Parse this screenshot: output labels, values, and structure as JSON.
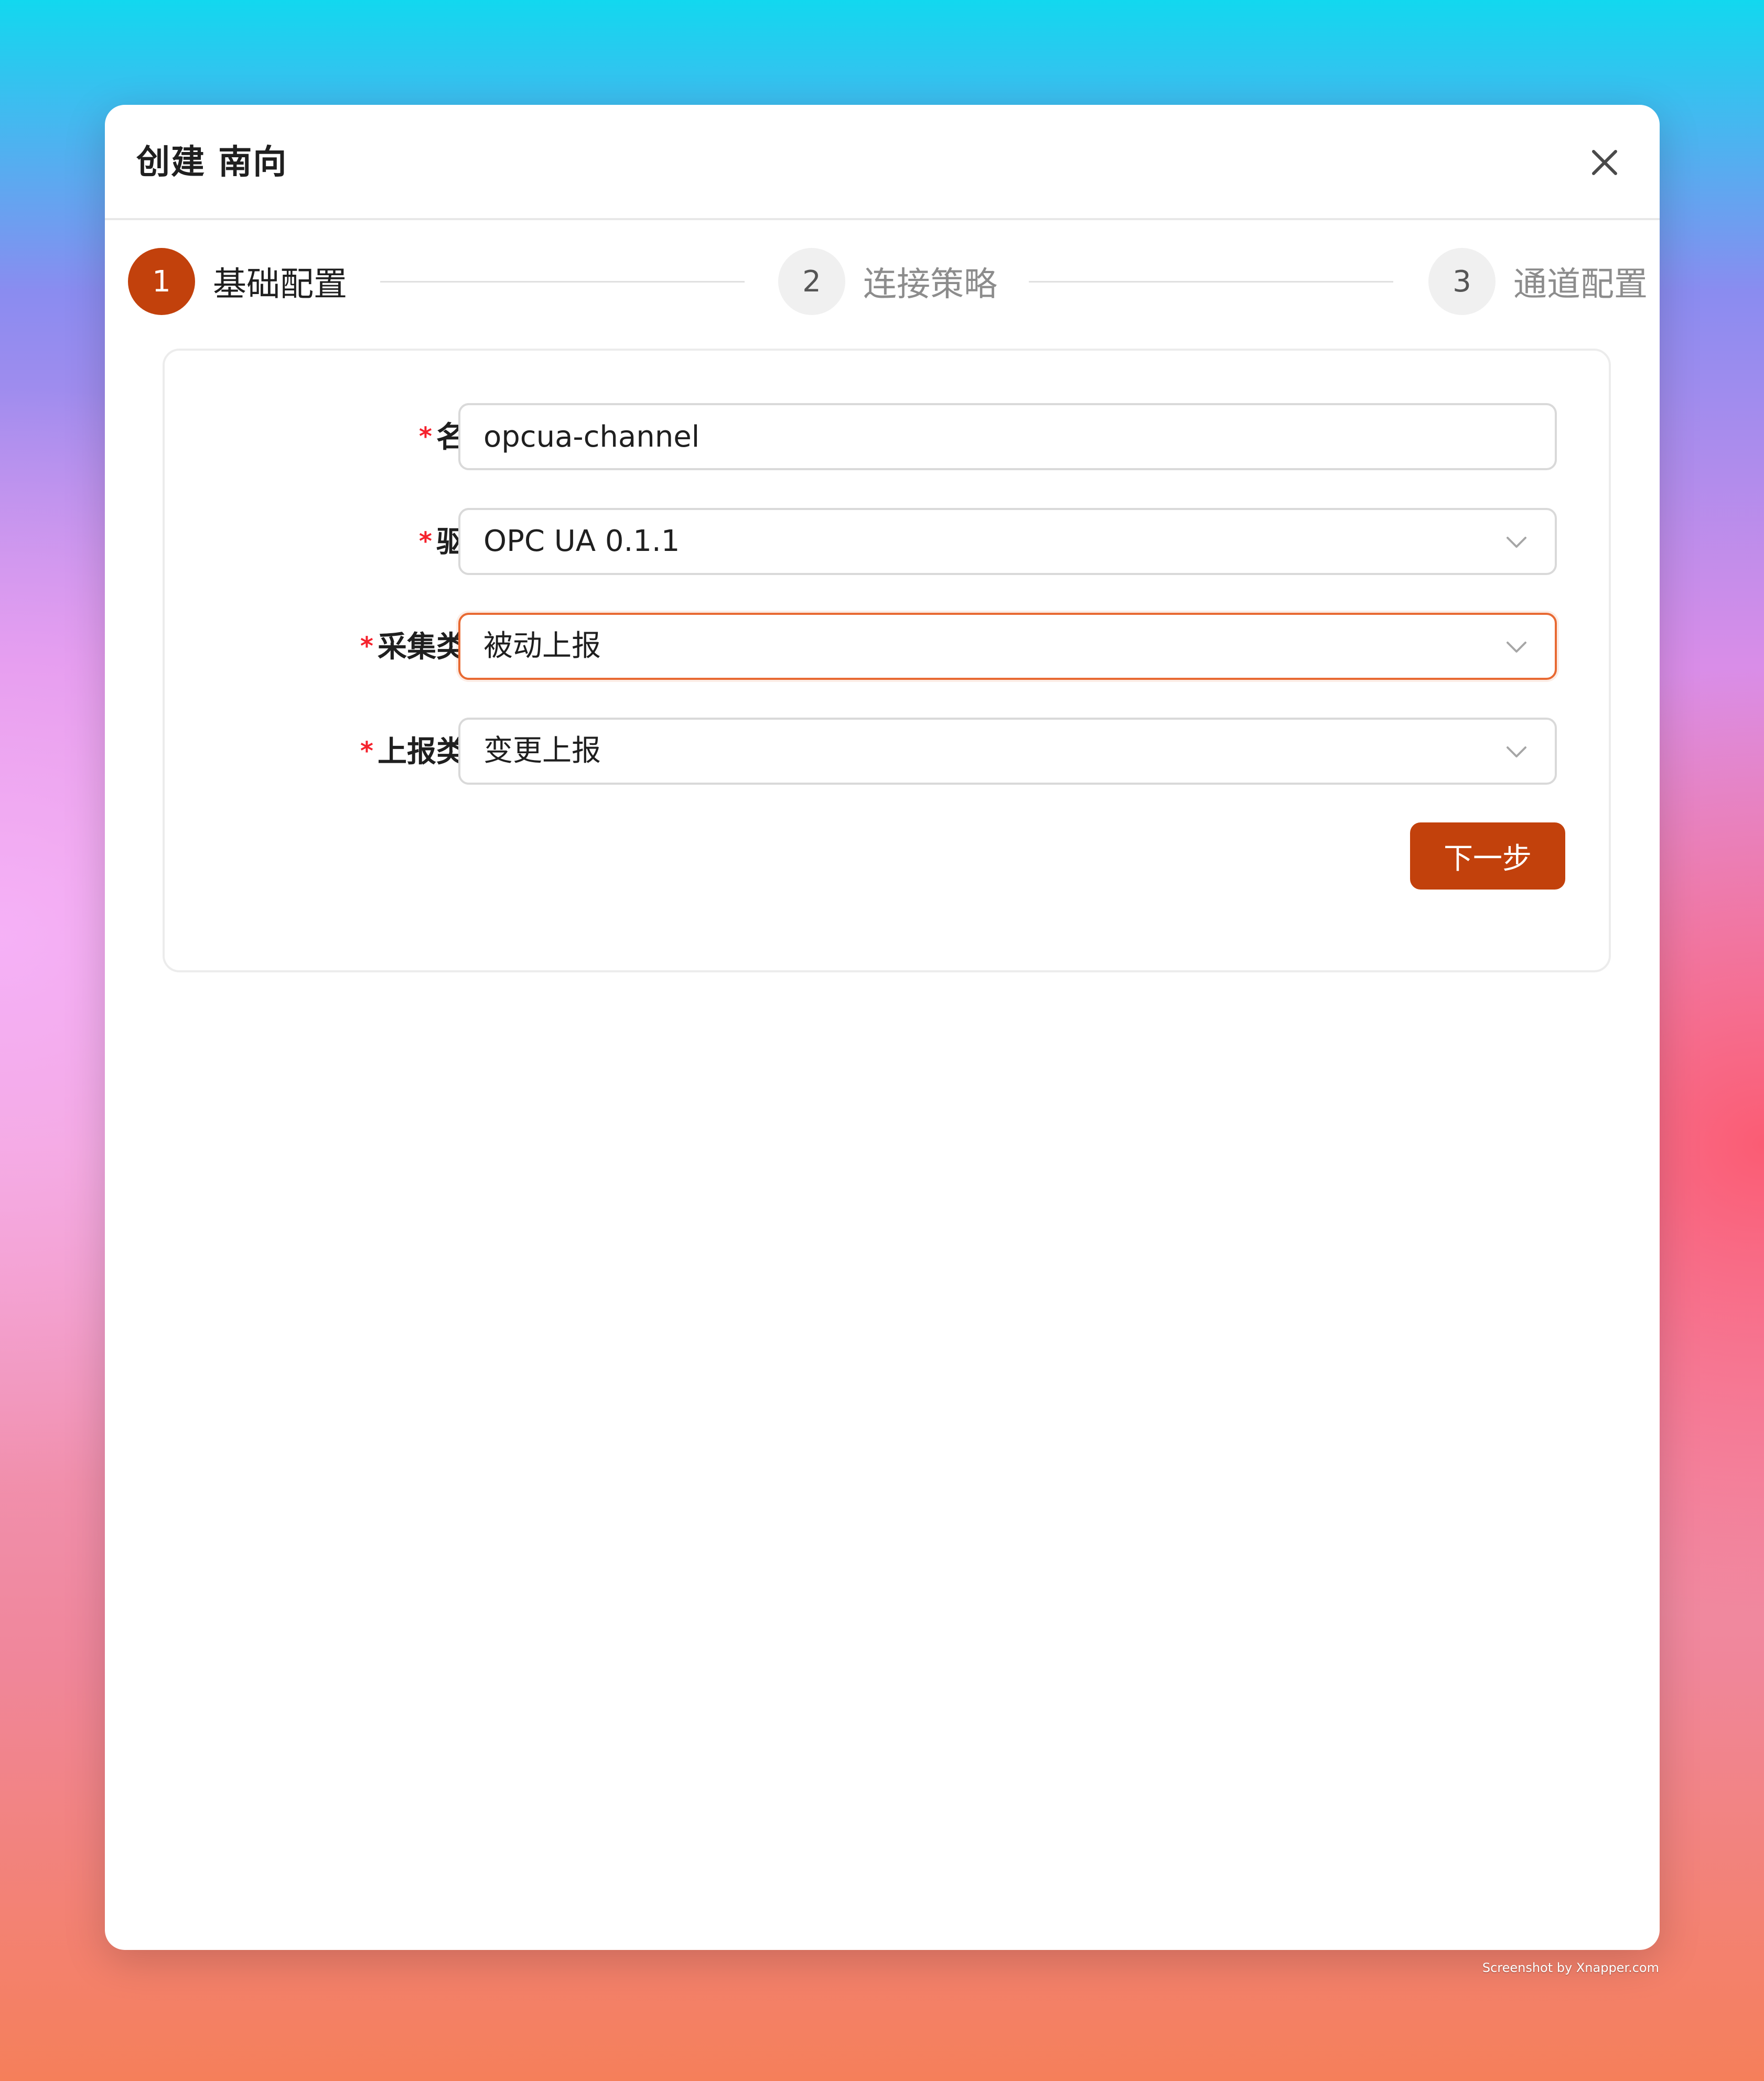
{
  "dialog": {
    "title": "创建 南向",
    "close_icon": "close-icon"
  },
  "steps": [
    {
      "number": "1",
      "label": "基础配置",
      "state": "active"
    },
    {
      "number": "2",
      "label": "连接策略",
      "state": "inactive"
    },
    {
      "number": "3",
      "label": "通道配置",
      "state": "inactive"
    }
  ],
  "form": {
    "required_mark": "*",
    "fields": [
      {
        "label": "名称",
        "type": "input",
        "value": "opcua-channel"
      },
      {
        "label": "驱动",
        "type": "select",
        "value": "OPC UA 0.1.1"
      },
      {
        "label": "采集类型",
        "type": "select",
        "value": "被动上报",
        "focused": true
      },
      {
        "label": "上报类型",
        "type": "select",
        "value": "变更上报"
      }
    ],
    "next_button": "下一步"
  },
  "colors": {
    "primary": "#c2410c",
    "focus_border": "#e86a33",
    "required": "#f5222d"
  },
  "watermark": "Screenshot by Xnapper.com"
}
